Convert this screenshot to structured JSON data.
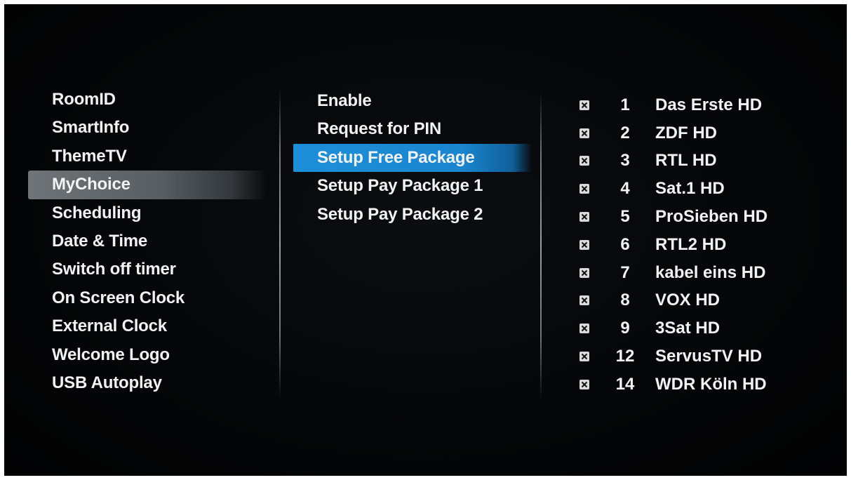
{
  "left_menu": {
    "items": [
      {
        "label": "RoomID"
      },
      {
        "label": "SmartInfo"
      },
      {
        "label": "ThemeTV"
      },
      {
        "label": "MyChoice"
      },
      {
        "label": "Scheduling"
      },
      {
        "label": "Date & Time"
      },
      {
        "label": "Switch off timer"
      },
      {
        "label": "On Screen Clock"
      },
      {
        "label": "External Clock"
      },
      {
        "label": "Welcome Logo"
      },
      {
        "label": "USB Autoplay"
      }
    ],
    "selected_index": 3
  },
  "middle_menu": {
    "items": [
      {
        "label": "Enable"
      },
      {
        "label": "Request for PIN"
      },
      {
        "label": "Setup Free Package"
      },
      {
        "label": "Setup Pay Package 1"
      },
      {
        "label": "Setup Pay Package 2"
      }
    ],
    "selected_index": 2
  },
  "channel_list": {
    "checkbox_icon": "checkbox-checked-icon",
    "channels": [
      {
        "number": "1",
        "name": "Das Erste HD",
        "checked": true
      },
      {
        "number": "2",
        "name": "ZDF HD",
        "checked": true
      },
      {
        "number": "3",
        "name": "RTL HD",
        "checked": true
      },
      {
        "number": "4",
        "name": "Sat.1 HD",
        "checked": true
      },
      {
        "number": "5",
        "name": "ProSieben HD",
        "checked": true
      },
      {
        "number": "6",
        "name": "RTL2 HD",
        "checked": true
      },
      {
        "number": "7",
        "name": "kabel eins HD",
        "checked": true
      },
      {
        "number": "8",
        "name": "VOX HD",
        "checked": true
      },
      {
        "number": "9",
        "name": "3Sat HD",
        "checked": true
      },
      {
        "number": "12",
        "name": "ServusTV HD",
        "checked": true
      },
      {
        "number": "14",
        "name": "WDR Köln HD",
        "checked": true
      }
    ]
  },
  "colors": {
    "background": "#050607",
    "text": "#f2f2f2",
    "selection_left": "#5e6468",
    "selection_mid": "#1c8fd8"
  }
}
